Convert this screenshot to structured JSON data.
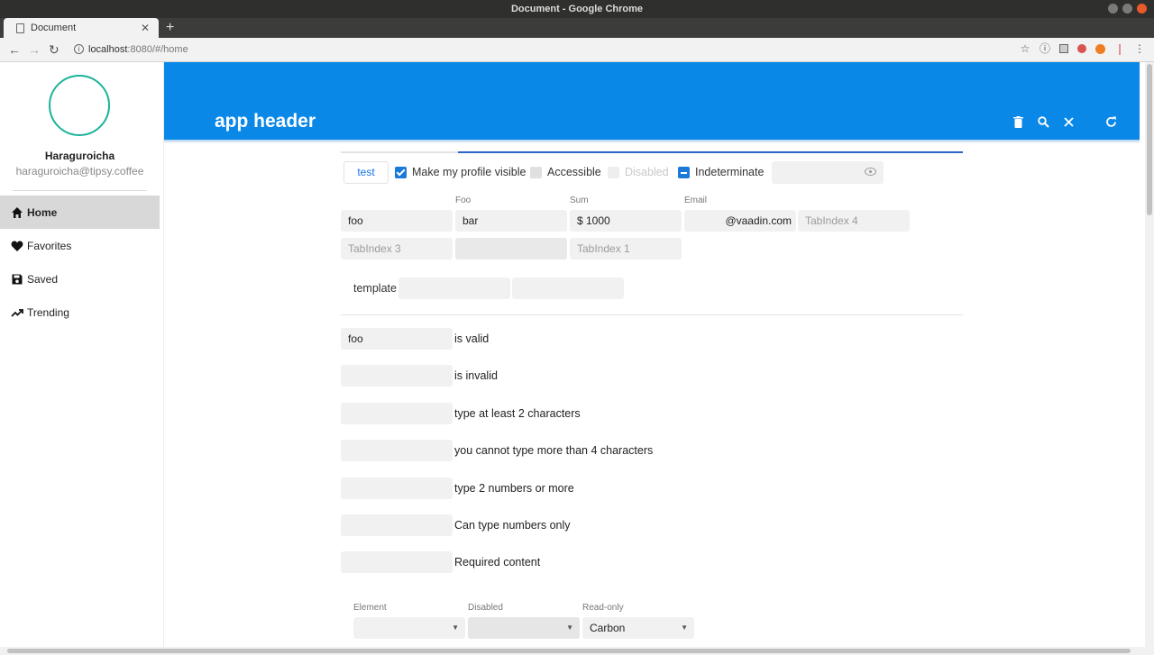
{
  "window": {
    "title": "Document - Google Chrome"
  },
  "browser": {
    "tab_title": "Document",
    "url_host": "localhost",
    "url_rest": ":8080/#/home"
  },
  "drawer": {
    "user_name": "Haraguroicha",
    "user_email": "haraguroicha@tipsy.coffee",
    "items": [
      {
        "label": "Home",
        "icon": "home-icon"
      },
      {
        "label": "Favorites",
        "icon": "heart-icon"
      },
      {
        "label": "Saved",
        "icon": "save-icon"
      },
      {
        "label": "Trending",
        "icon": "trending-up-icon"
      }
    ]
  },
  "header": {
    "title": "app header",
    "icons": [
      "delete-icon",
      "search-icon",
      "close-icon",
      "refresh-icon"
    ]
  },
  "row1": {
    "button_label": "test",
    "checkboxes": [
      {
        "label": "Make my profile visible",
        "state": "checked"
      },
      {
        "label": "Accessible",
        "state": "unchecked"
      },
      {
        "label": "Disabled",
        "state": "disabled"
      },
      {
        "label": "Indeterminate",
        "state": "indeterminate"
      }
    ]
  },
  "form": {
    "labels": {
      "foo": "Foo",
      "sum": "Sum",
      "email": "Email"
    },
    "values": {
      "f1": "foo",
      "f2": "bar",
      "sum": "$ 1000",
      "email": "@vaadin.com"
    },
    "placeholders": {
      "tab4": "TabIndex 4",
      "tab3": "TabIndex 3",
      "tab1": "TabIndex 1"
    },
    "template_label": "template"
  },
  "validation": [
    {
      "value": "foo",
      "label": "is valid"
    },
    {
      "value": "",
      "label": "is invalid"
    },
    {
      "value": "",
      "label": "type at least 2 characters"
    },
    {
      "value": "",
      "label": "you cannot type more than 4 characters"
    },
    {
      "value": "",
      "label": "type 2 numbers or more"
    },
    {
      "value": "",
      "label": "Can type numbers only"
    },
    {
      "value": "",
      "label": "Required content"
    }
  ],
  "selects": [
    {
      "label": "Element",
      "value": ""
    },
    {
      "label": "Disabled",
      "value": ""
    },
    {
      "label": "Read-only",
      "value": "Carbon"
    }
  ],
  "colors": {
    "header": "#0a88e8",
    "accent": "#1a7ad8",
    "avatar_ring": "#1bb39a"
  }
}
